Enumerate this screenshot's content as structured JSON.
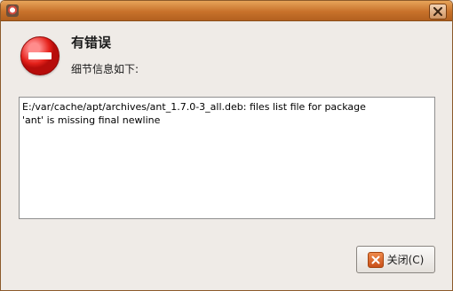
{
  "dialog": {
    "primary_text": "有错误",
    "secondary_text": "细节信息如下:"
  },
  "details": {
    "text": "E:/var/cache/apt/archives/ant_1.7.0-3_all.deb: files list file for package\n'ant' is missing final newline"
  },
  "buttons": {
    "close_label": "关闭(C)"
  },
  "icons": {
    "title_close": "close-icon",
    "error": "dialog-error-icon",
    "button_close": "close-icon"
  }
}
